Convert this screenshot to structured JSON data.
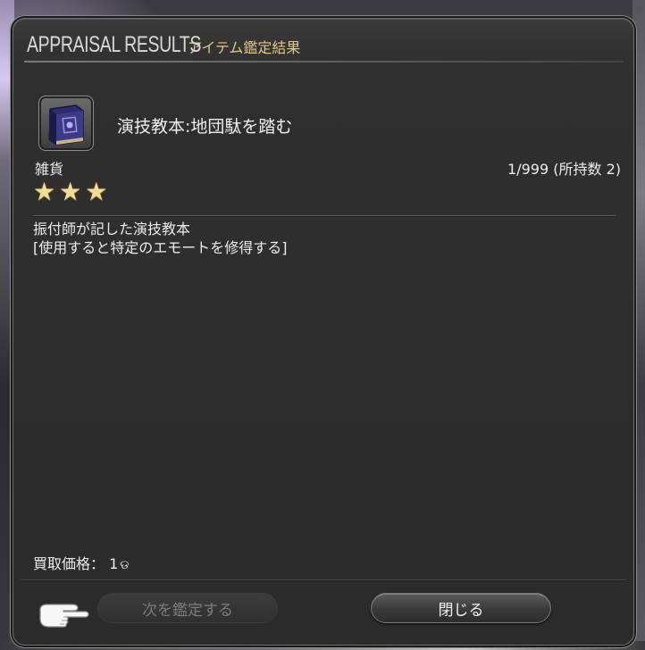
{
  "window": {
    "title_en": "APPRAISAL RESULTS",
    "title_jp": "アイテム鑑定結果"
  },
  "item": {
    "icon": "book-icon",
    "name": "演技教本:地団駄を踏む",
    "category": "雑貨",
    "stock": "1/999 (所持数 2)",
    "rating_stars": 3,
    "description_line1": "振付師が記した演技教本",
    "description_line2": "[使用すると特定のエモートを修得する]",
    "price_label": "買取価格：",
    "price_value": "1",
    "price_unit": "ଡ"
  },
  "buttons": {
    "next_label": "次を鑑定する",
    "close_label": "閉じる"
  },
  "colors": {
    "title_jp": "#e0c88a",
    "star": "#f2dc9a",
    "panel": "#2b2b2b",
    "disabled_text": "#7c7c7c"
  }
}
